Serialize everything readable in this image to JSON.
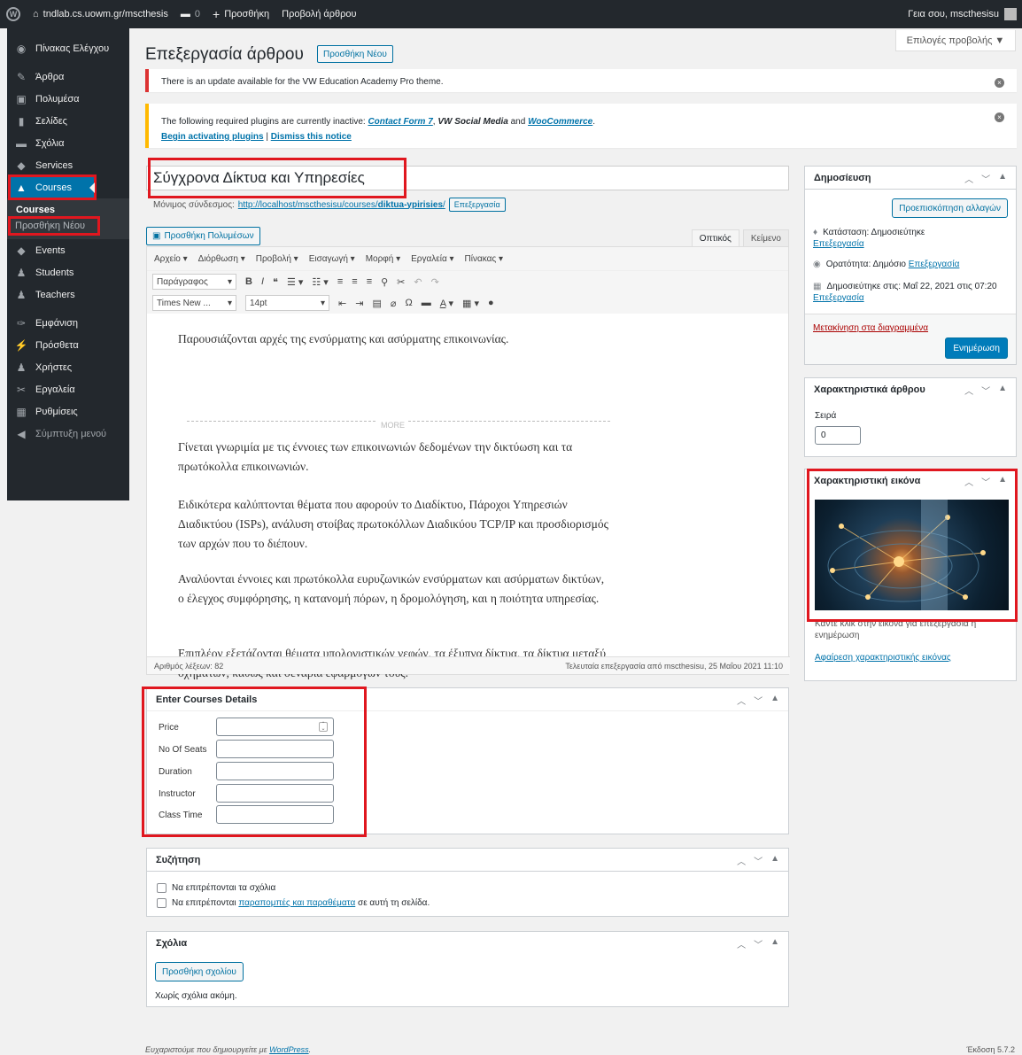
{
  "adminbar": {
    "site": "tndlab.cs.uowm.gr/mscthesis",
    "comments_count": "0",
    "new_label": "Προσθήκη",
    "view_post": "Προβολή άρθρου",
    "greeting": "Γεια σου, mscthesisu"
  },
  "sidebar": {
    "items": [
      {
        "label": "Πίνακας Ελέγχου",
        "icon": "dashboard-icon"
      },
      {
        "label": "Άρθρα",
        "icon": "pin-icon"
      },
      {
        "label": "Πολυμέσα",
        "icon": "media-icon"
      },
      {
        "label": "Σελίδες",
        "icon": "page-icon"
      },
      {
        "label": "Σχόλια",
        "icon": "comment-icon"
      },
      {
        "label": "Services",
        "icon": "thumbtack-icon"
      },
      {
        "label": "Courses",
        "icon": "graduation-cap-icon"
      },
      {
        "label": "Events",
        "icon": "thumbtack-icon"
      },
      {
        "label": "Students",
        "icon": "users-icon"
      },
      {
        "label": "Teachers",
        "icon": "users-icon"
      },
      {
        "label": "Εμφάνιση",
        "icon": "brush-icon"
      },
      {
        "label": "Πρόσθετα",
        "icon": "plugin-icon"
      },
      {
        "label": "Χρήστες",
        "icon": "user-icon"
      },
      {
        "label": "Εργαλεία",
        "icon": "wrench-icon"
      },
      {
        "label": "Ρυθμίσεις",
        "icon": "settings-icon"
      },
      {
        "label": "Σύμπτυξη μενού",
        "icon": "collapse-icon"
      }
    ],
    "submenu": {
      "courses": "Courses",
      "add_new": "Προσθήκη Νέου"
    }
  },
  "screen_options": "Επιλογές προβολής ▼",
  "page": {
    "title": "Επεξεργασία άρθρου",
    "add_new": "Προσθήκη Νέου"
  },
  "notices": {
    "update": "There is an update available for the VW Education Academy Pro theme.",
    "plugins_prefix": "The following required plugins are currently inactive: ",
    "plugin1": "Contact Form 7",
    "sep1": ", ",
    "plugin2": "VW Social Media",
    "and": " and ",
    "plugin3": "WooCommerce",
    "end": ".",
    "begin": "Begin activating plugins",
    "pipe": " | ",
    "dismiss": "Dismiss this notice"
  },
  "post": {
    "title": "Σύγχρονα Δίκτυα και Υπηρεσίες",
    "permalink_label": "Μόνιμος σύνδεσμος:",
    "permalink_url": "http://localhost/mscthesisu/courses/",
    "permalink_slug": "diktua-ypirisies",
    "permalink_end": "/",
    "edit_slug": "Επεξεργασία"
  },
  "editor": {
    "add_media": "Προσθήκη Πολυμέσων",
    "tab_visual": "Οπτικός",
    "tab_text": "Κείμενο",
    "menus": [
      "Αρχείο ▾",
      "Διόρθωση ▾",
      "Προβολή ▾",
      "Εισαγωγή ▾",
      "Μορφή ▾",
      "Εργαλεία ▾",
      "Πίνακας ▾"
    ],
    "format_select": "Παράγραφος",
    "font_select": "Times New ...",
    "size_select": "14pt",
    "paragraphs": [
      "Παρουσιάζονται αρχές της ενσύρματης και ασύρματης επικοινωνίας.",
      "Γίνεται γνωριμία με τις έννοιες των επικοινωνιών δεδομένων την δικτύωση και τα πρωτόκολλα επικοινωνιών.",
      "Ειδικότερα καλύπτονται θέματα που αφορούν το Διαδίκτυο, Πάροχοι Υπηρεσιών Διαδικτύου (ISPs), ανάλυση στοίβας πρωτοκόλλων Διαδικύου TCP/IP και προσδιορισμός των αρχών που το διέπουν.",
      "Αναλύονται έννοιες και πρωτόκολλα ευρυζωνικών ενσύρματων και ασύρματων δικτύων, ο έλεγχος συμφόρησης, η κατανομή πόρων, η δρομολόγηση, και η ποιότητα υπηρεσίας.",
      "Επιπλέον εξετάζονται θέματα υπολογιστικών νεφών, τα έξυπνα δίκτυα, τα δίκτυα μεταξύ οχημάτων, καθώς και σενάρια εφαρμογών τους."
    ],
    "more": "MORE",
    "word_count": "Αριθμός λέξεων: 82",
    "last_edit": "Τελευταία επεξεργασία από mscthesisu, 25 Μαΐου 2021 11:10"
  },
  "course_details": {
    "title": "Enter Courses Details",
    "fields": [
      "Price",
      "No Of Seats",
      "Duration",
      "Instructor",
      "Class Time"
    ]
  },
  "discussion": {
    "title": "Συζήτηση",
    "allow_comments": "Να επιτρέπονται τα σχόλια",
    "allow_pings_prefix": "Να επιτρέπονται ",
    "allow_pings_link": "παραπομπές και παραθέματα",
    "allow_pings_suffix": " σε αυτή τη σελίδα."
  },
  "comments": {
    "title": "Σχόλια",
    "add": "Προσθήκη σχολίου",
    "none": "Χωρίς σχόλια ακόμη."
  },
  "publish": {
    "title": "Δημοσίευση",
    "preview": "Προεπισκόπηση αλλαγών",
    "status_label": "Κατάσταση: Δημοσιεύτηκε",
    "status_edit": "Επεξεργασία",
    "visibility_label": "Ορατότητα: Δημόσιο",
    "visibility_edit": "Επεξεργασία",
    "published_label": "Δημοσιεύτηκε στις: Μαΐ 22, 2021 στις 07:20",
    "published_edit": "Επεξεργασία",
    "trash": "Μετακίνηση στα διαγραμμένα",
    "update": "Ενημέρωση"
  },
  "attributes": {
    "title": "Χαρακτηριστικά άρθρου",
    "order_label": "Σειρά",
    "order_value": "0"
  },
  "featured": {
    "title": "Χαρακτηριστική εικόνα",
    "hint": "Κάντε κλικ στην εικόνα για επεξεργασία ή ενημέρωση",
    "remove": "Αφαίρεση χαρακτηριστικής εικόνας"
  },
  "footer": {
    "thanks_prefix": "Ευχαριστούμε που δημιουργείτε με ",
    "thanks_link": "WordPress",
    "thanks_end": ".",
    "version": "Έκδοση 5.7.2"
  }
}
